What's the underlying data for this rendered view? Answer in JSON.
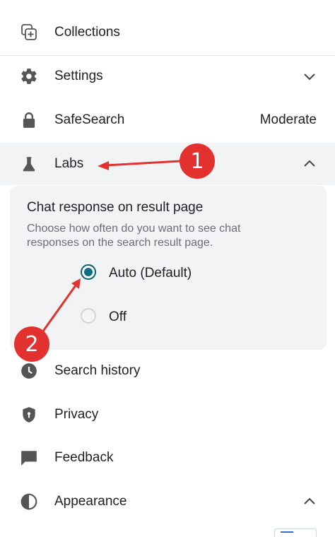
{
  "menu": {
    "collections": {
      "label": "Collections",
      "icon": "collections-icon"
    },
    "settings": {
      "label": "Settings",
      "icon": "gear-icon",
      "expanded": false
    },
    "safesearch": {
      "label": "SafeSearch",
      "icon": "lock-icon",
      "value": "Moderate"
    },
    "labs": {
      "label": "Labs",
      "icon": "flask-icon",
      "expanded": true
    },
    "search_history": {
      "label": "Search history",
      "icon": "clock-icon"
    },
    "privacy": {
      "label": "Privacy",
      "icon": "shield-icon"
    },
    "feedback": {
      "label": "Feedback",
      "icon": "feedback-icon"
    },
    "appearance": {
      "label": "Appearance",
      "icon": "contrast-icon",
      "expanded": true
    }
  },
  "labs_panel": {
    "title": "Chat response on result page",
    "description": "Choose how often do you want to see chat responses on the search result page.",
    "options": [
      {
        "label": "Auto (Default)",
        "selected": true
      },
      {
        "label": "Off",
        "selected": false
      }
    ]
  },
  "annotations": [
    {
      "number": "1"
    },
    {
      "number": "2"
    }
  ],
  "colors": {
    "accent": "#0a6e85",
    "annotation": "#e3312f",
    "panel_bg": "#f1f3f4"
  }
}
